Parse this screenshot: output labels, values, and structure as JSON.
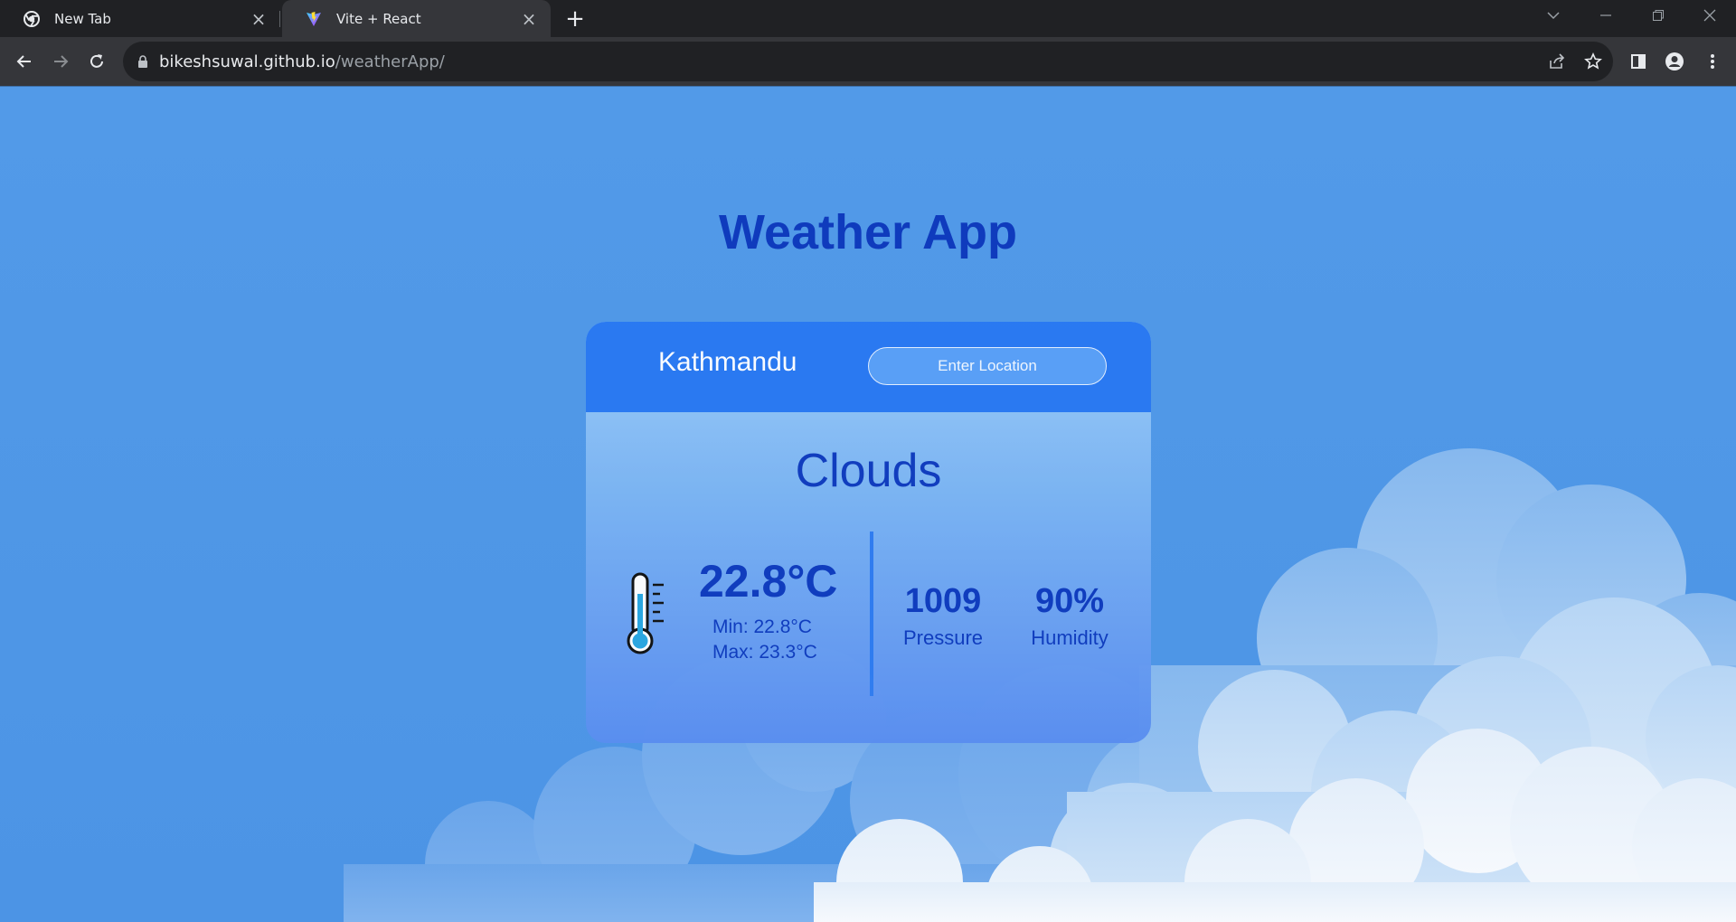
{
  "browser": {
    "tabs": [
      {
        "title": "New Tab",
        "favicon": "chrome-icon",
        "active": false
      },
      {
        "title": "Vite + React",
        "favicon": "vite-icon",
        "active": true
      }
    ],
    "url_host": "bikeshsuwal.github.io",
    "url_path": "/weatherApp/"
  },
  "app": {
    "title": "Weather App",
    "city": "Kathmandu",
    "location_placeholder": "Enter Location",
    "condition": "Clouds",
    "temperature": "22.8°C",
    "min": "Min: 22.8°C",
    "max": "Max: 23.3°C",
    "pressure": {
      "value": "1009",
      "label": "Pressure"
    },
    "humidity": {
      "value": "90%",
      "label": "Humidity"
    }
  },
  "colors": {
    "page_background": "#4f97e6",
    "heading_blue": "#0f3bbd",
    "card_header": "#2979f2"
  }
}
